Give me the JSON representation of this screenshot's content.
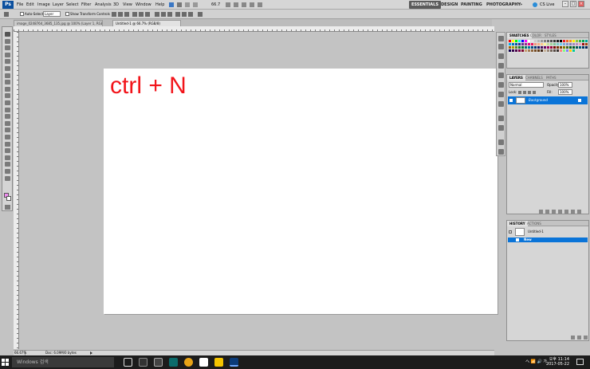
{
  "app": {
    "logo": "Ps"
  },
  "menu": [
    "File",
    "Edit",
    "Image",
    "Layer",
    "Select",
    "Filter",
    "Analysis",
    "3D",
    "View",
    "Window",
    "Help"
  ],
  "zoom_select": "66.7",
  "workspaces": [
    "ESSENTIALS",
    "DESIGN",
    "PAINTING",
    "PHOTOGRAPHY"
  ],
  "workspace_more": "»",
  "cs_live": "CS Live",
  "options": {
    "auto_select_label": "Auto-Select:",
    "auto_select_value": "Layer",
    "show_transform_label": "Show Transform Controls"
  },
  "tabs": [
    {
      "label": "image_0248764_3685_135.jpg @ 100% (Layer 1, RGB/8#)",
      "active": false
    },
    {
      "label": "Untitled-1 @ 66.7% (RGB/8)",
      "active": true
    }
  ],
  "canvas": {
    "overlay_text": "ctrl + N"
  },
  "status": {
    "zoom": "66.67%",
    "doc": "Doc: 6.09M/0 bytes"
  },
  "panels": {
    "swatches_tabs": [
      "SWATCHES",
      "COLOR",
      "STYLES"
    ],
    "layers_tabs": [
      "LAYERS",
      "CHANNELS",
      "PATHS"
    ],
    "blend_mode": "Normal",
    "opacity_label": "Opacity:",
    "opacity": "100%",
    "lock_label": "Lock:",
    "fill_label": "Fill:",
    "fill": "100%",
    "layer_name": "Background",
    "history_tabs": [
      "HISTORY",
      "ACTIONS"
    ],
    "history_doc": "Untitled-1",
    "history_step": "New"
  },
  "swatch_colors": [
    "#ff0000",
    "#ffff00",
    "#00ff00",
    "#00ffff",
    "#0000ff",
    "#ff00ff",
    "#ffffff",
    "#e6e6e6",
    "#cccccc",
    "#b3b3b3",
    "#999999",
    "#808080",
    "#666666",
    "#4d4d4d",
    "#333333",
    "#1a1a1a",
    "#000000",
    "#ed1c24",
    "#f26522",
    "#f7941d",
    "#fff200",
    "#8dc63f",
    "#39b54a",
    "#00a651",
    "#00a99d",
    "#00aeef",
    "#0072bc",
    "#0054a6",
    "#2e3192",
    "#662d91",
    "#92278f",
    "#ec008c",
    "#ed145b",
    "#f69679",
    "#f9ad81",
    "#fdc689",
    "#fff799",
    "#c4df9b",
    "#a3d39c",
    "#82ca9c",
    "#7accc8",
    "#6dcff6",
    "#7da7d9",
    "#8393ca",
    "#8781bd",
    "#a187be",
    "#bc8dbf",
    "#f49ac2",
    "#9e0b0f",
    "#a0410d",
    "#a36209",
    "#aba000",
    "#598527",
    "#1a7b30",
    "#007236",
    "#00746b",
    "#0076a3",
    "#004b80",
    "#003471",
    "#1b1464",
    "#440e62",
    "#630460",
    "#9e005d",
    "#9e0039",
    "#790000",
    "#7b2e00",
    "#7d4900",
    "#827b00",
    "#406618",
    "#005e20",
    "#005826",
    "#005952",
    "#005b7f",
    "#003663",
    "#002157",
    "#0d004c",
    "#32004b",
    "#4b0049",
    "#7b0046",
    "#7a0026",
    "#c69c6d",
    "#a67c52",
    "#8c6239",
    "#754c24",
    "#603913",
    "#3c2415",
    "#c7b299",
    "#998675",
    "#736357",
    "#534741",
    "#362f2d",
    "#ff8080",
    "#80ff80",
    "#8080ff",
    "#ffcc00",
    "#00cc99"
  ],
  "taskbar": {
    "search_placeholder": "Windows 검색",
    "lang": "へ 📶 🔊 가",
    "time": "오후 11:14",
    "date": "2017-05-22"
  }
}
